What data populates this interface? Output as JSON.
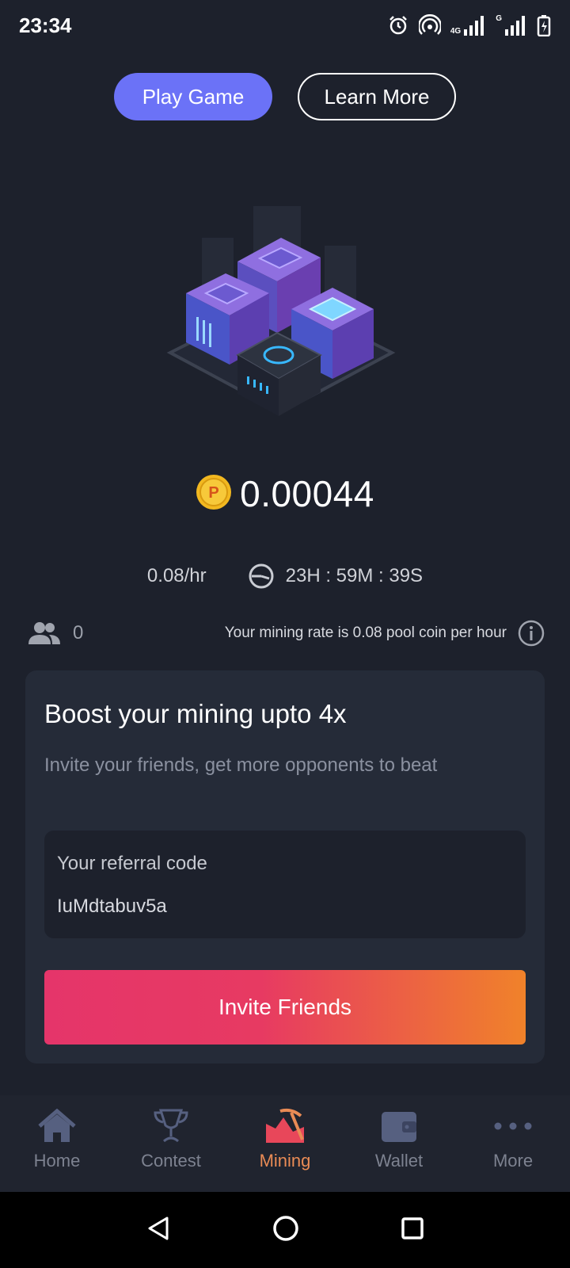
{
  "status_bar": {
    "time": "23:34",
    "icons": [
      "alarm-icon",
      "hotspot-icon",
      "signal-4g-icon",
      "signal-g-icon",
      "battery-charging-icon"
    ],
    "net_4g": "4G",
    "net_g": "G"
  },
  "top_buttons": {
    "play_label": "Play Game",
    "learn_label": "Learn More",
    "play_color": "#6b72f7"
  },
  "balance": {
    "value": "0.00044",
    "coin_icon": "pool-coin-icon",
    "coin_letter": "P"
  },
  "rate": {
    "per_hour": "0.08/hr",
    "timer": "23H : 59M : 39S"
  },
  "info": {
    "friends_count": "0",
    "rate_note": "Your mining rate is 0.08 pool coin per hour"
  },
  "boost": {
    "title": "Boost your mining upto 4x",
    "subtitle": "Invite your friends, get more opponents to beat",
    "referral_label": "Your referral code",
    "referral_code": "IuMdtabuv5a",
    "invite_label": "Invite Friends"
  },
  "bottom_nav": {
    "items": [
      {
        "label": "Home",
        "icon": "home-icon",
        "active": false
      },
      {
        "label": "Contest",
        "icon": "trophy-icon",
        "active": false
      },
      {
        "label": "Mining",
        "icon": "mining-icon",
        "active": true
      },
      {
        "label": "Wallet",
        "icon": "wallet-icon",
        "active": false
      },
      {
        "label": "More",
        "icon": "more-dots-icon",
        "active": false
      }
    ],
    "active_color": "#e98b55"
  },
  "android_nav": {
    "icons": [
      "back-icon",
      "home-circle-icon",
      "recents-icon"
    ]
  }
}
